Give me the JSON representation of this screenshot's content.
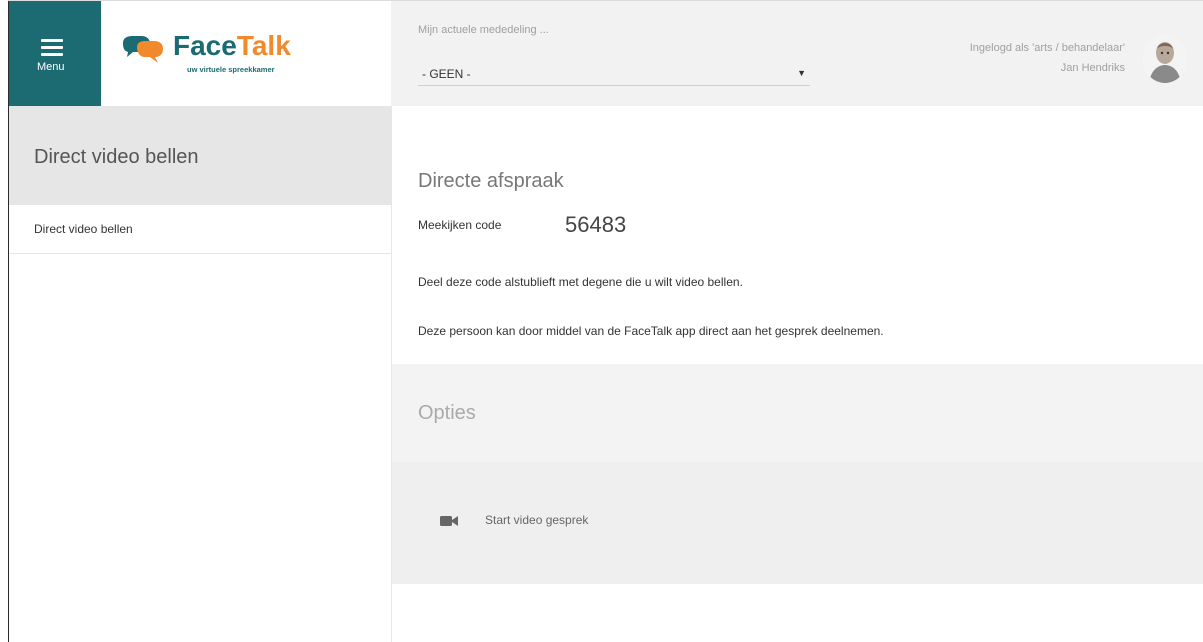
{
  "header": {
    "menu_label": "Menu",
    "logo": {
      "face": "Face",
      "talk": "Talk",
      "tagline": "uw virtuele spreekkamer"
    },
    "announcement": {
      "label": "Mijn actuele mededeling ...",
      "selected": "- GEEN -"
    },
    "user": {
      "role": "Ingelogd als 'arts / behandelaar'",
      "name": "Jan Hendriks"
    }
  },
  "sidebar": {
    "title": "Direct video bellen",
    "items": [
      {
        "label": "Direct video bellen"
      }
    ]
  },
  "main": {
    "title": "Directe afspraak",
    "code_label": "Meekijken code",
    "code_value": "56483",
    "desc1": "Deel deze code alstublieft met degene die u wilt video bellen.",
    "desc2": "Deze persoon kan door middel van de FaceTalk app direct aan het gesprek deelnemen.",
    "options": {
      "title": "Opties",
      "start_video_label": "Start video gesprek"
    }
  },
  "colors": {
    "brand_teal": "#1c6b72",
    "brand_orange": "#f08a2c"
  },
  "icons": [
    "hamburger-menu-icon",
    "facetalk-logo-icon",
    "chevron-down-icon",
    "avatar",
    "video-camera-icon"
  ]
}
